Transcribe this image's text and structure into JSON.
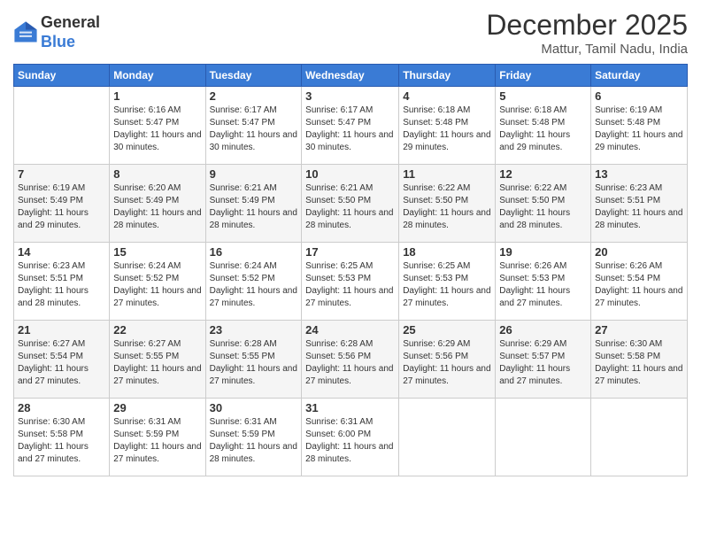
{
  "logo": {
    "general": "General",
    "blue": "Blue"
  },
  "header": {
    "month": "December 2025",
    "location": "Mattur, Tamil Nadu, India"
  },
  "days_of_week": [
    "Sunday",
    "Monday",
    "Tuesday",
    "Wednesday",
    "Thursday",
    "Friday",
    "Saturday"
  ],
  "weeks": [
    [
      {
        "day": "",
        "sunrise": "",
        "sunset": "",
        "daylight": ""
      },
      {
        "day": "1",
        "sunrise": "Sunrise: 6:16 AM",
        "sunset": "Sunset: 5:47 PM",
        "daylight": "Daylight: 11 hours and 30 minutes."
      },
      {
        "day": "2",
        "sunrise": "Sunrise: 6:17 AM",
        "sunset": "Sunset: 5:47 PM",
        "daylight": "Daylight: 11 hours and 30 minutes."
      },
      {
        "day": "3",
        "sunrise": "Sunrise: 6:17 AM",
        "sunset": "Sunset: 5:47 PM",
        "daylight": "Daylight: 11 hours and 30 minutes."
      },
      {
        "day": "4",
        "sunrise": "Sunrise: 6:18 AM",
        "sunset": "Sunset: 5:48 PM",
        "daylight": "Daylight: 11 hours and 29 minutes."
      },
      {
        "day": "5",
        "sunrise": "Sunrise: 6:18 AM",
        "sunset": "Sunset: 5:48 PM",
        "daylight": "Daylight: 11 hours and 29 minutes."
      },
      {
        "day": "6",
        "sunrise": "Sunrise: 6:19 AM",
        "sunset": "Sunset: 5:48 PM",
        "daylight": "Daylight: 11 hours and 29 minutes."
      }
    ],
    [
      {
        "day": "7",
        "sunrise": "Sunrise: 6:19 AM",
        "sunset": "Sunset: 5:49 PM",
        "daylight": "Daylight: 11 hours and 29 minutes."
      },
      {
        "day": "8",
        "sunrise": "Sunrise: 6:20 AM",
        "sunset": "Sunset: 5:49 PM",
        "daylight": "Daylight: 11 hours and 28 minutes."
      },
      {
        "day": "9",
        "sunrise": "Sunrise: 6:21 AM",
        "sunset": "Sunset: 5:49 PM",
        "daylight": "Daylight: 11 hours and 28 minutes."
      },
      {
        "day": "10",
        "sunrise": "Sunrise: 6:21 AM",
        "sunset": "Sunset: 5:50 PM",
        "daylight": "Daylight: 11 hours and 28 minutes."
      },
      {
        "day": "11",
        "sunrise": "Sunrise: 6:22 AM",
        "sunset": "Sunset: 5:50 PM",
        "daylight": "Daylight: 11 hours and 28 minutes."
      },
      {
        "day": "12",
        "sunrise": "Sunrise: 6:22 AM",
        "sunset": "Sunset: 5:50 PM",
        "daylight": "Daylight: 11 hours and 28 minutes."
      },
      {
        "day": "13",
        "sunrise": "Sunrise: 6:23 AM",
        "sunset": "Sunset: 5:51 PM",
        "daylight": "Daylight: 11 hours and 28 minutes."
      }
    ],
    [
      {
        "day": "14",
        "sunrise": "Sunrise: 6:23 AM",
        "sunset": "Sunset: 5:51 PM",
        "daylight": "Daylight: 11 hours and 28 minutes."
      },
      {
        "day": "15",
        "sunrise": "Sunrise: 6:24 AM",
        "sunset": "Sunset: 5:52 PM",
        "daylight": "Daylight: 11 hours and 27 minutes."
      },
      {
        "day": "16",
        "sunrise": "Sunrise: 6:24 AM",
        "sunset": "Sunset: 5:52 PM",
        "daylight": "Daylight: 11 hours and 27 minutes."
      },
      {
        "day": "17",
        "sunrise": "Sunrise: 6:25 AM",
        "sunset": "Sunset: 5:53 PM",
        "daylight": "Daylight: 11 hours and 27 minutes."
      },
      {
        "day": "18",
        "sunrise": "Sunrise: 6:25 AM",
        "sunset": "Sunset: 5:53 PM",
        "daylight": "Daylight: 11 hours and 27 minutes."
      },
      {
        "day": "19",
        "sunrise": "Sunrise: 6:26 AM",
        "sunset": "Sunset: 5:53 PM",
        "daylight": "Daylight: 11 hours and 27 minutes."
      },
      {
        "day": "20",
        "sunrise": "Sunrise: 6:26 AM",
        "sunset": "Sunset: 5:54 PM",
        "daylight": "Daylight: 11 hours and 27 minutes."
      }
    ],
    [
      {
        "day": "21",
        "sunrise": "Sunrise: 6:27 AM",
        "sunset": "Sunset: 5:54 PM",
        "daylight": "Daylight: 11 hours and 27 minutes."
      },
      {
        "day": "22",
        "sunrise": "Sunrise: 6:27 AM",
        "sunset": "Sunset: 5:55 PM",
        "daylight": "Daylight: 11 hours and 27 minutes."
      },
      {
        "day": "23",
        "sunrise": "Sunrise: 6:28 AM",
        "sunset": "Sunset: 5:55 PM",
        "daylight": "Daylight: 11 hours and 27 minutes."
      },
      {
        "day": "24",
        "sunrise": "Sunrise: 6:28 AM",
        "sunset": "Sunset: 5:56 PM",
        "daylight": "Daylight: 11 hours and 27 minutes."
      },
      {
        "day": "25",
        "sunrise": "Sunrise: 6:29 AM",
        "sunset": "Sunset: 5:56 PM",
        "daylight": "Daylight: 11 hours and 27 minutes."
      },
      {
        "day": "26",
        "sunrise": "Sunrise: 6:29 AM",
        "sunset": "Sunset: 5:57 PM",
        "daylight": "Daylight: 11 hours and 27 minutes."
      },
      {
        "day": "27",
        "sunrise": "Sunrise: 6:30 AM",
        "sunset": "Sunset: 5:58 PM",
        "daylight": "Daylight: 11 hours and 27 minutes."
      }
    ],
    [
      {
        "day": "28",
        "sunrise": "Sunrise: 6:30 AM",
        "sunset": "Sunset: 5:58 PM",
        "daylight": "Daylight: 11 hours and 27 minutes."
      },
      {
        "day": "29",
        "sunrise": "Sunrise: 6:31 AM",
        "sunset": "Sunset: 5:59 PM",
        "daylight": "Daylight: 11 hours and 27 minutes."
      },
      {
        "day": "30",
        "sunrise": "Sunrise: 6:31 AM",
        "sunset": "Sunset: 5:59 PM",
        "daylight": "Daylight: 11 hours and 28 minutes."
      },
      {
        "day": "31",
        "sunrise": "Sunrise: 6:31 AM",
        "sunset": "Sunset: 6:00 PM",
        "daylight": "Daylight: 11 hours and 28 minutes."
      },
      {
        "day": "",
        "sunrise": "",
        "sunset": "",
        "daylight": ""
      },
      {
        "day": "",
        "sunrise": "",
        "sunset": "",
        "daylight": ""
      },
      {
        "day": "",
        "sunrise": "",
        "sunset": "",
        "daylight": ""
      }
    ]
  ]
}
